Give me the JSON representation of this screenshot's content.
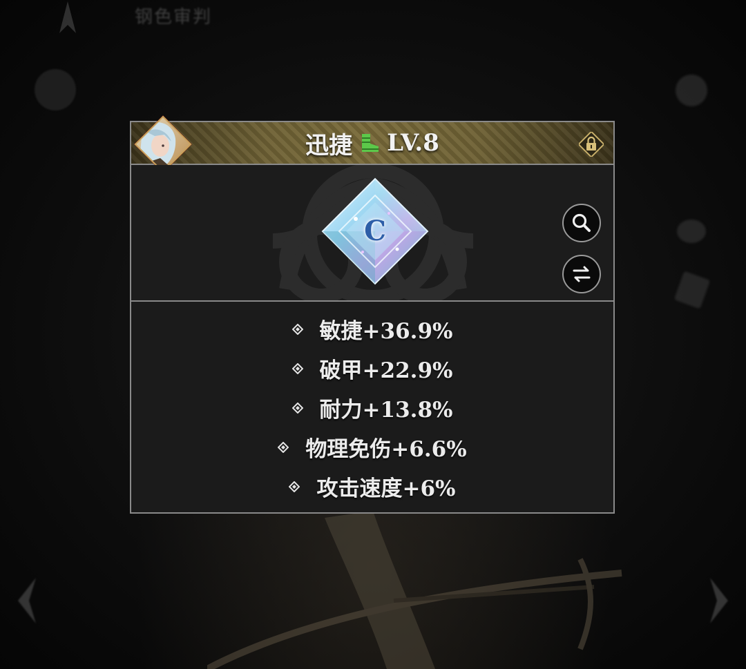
{
  "background": {
    "top_label": "钢色审判"
  },
  "panel": {
    "title": "迅捷",
    "level": "LV.8",
    "gem_grade": "C",
    "icons": {
      "portrait": "character-portrait-icon",
      "boot": "boot-icon",
      "lock": "lock-icon",
      "search": "magnifier-icon",
      "swap": "swap-arrows-icon"
    },
    "colors": {
      "header_gold": "#7a6b3a",
      "boot_green": "#5cc84a",
      "panel_border": "#8a8a8a"
    }
  },
  "stats": [
    {
      "label": "敏捷+36.9%"
    },
    {
      "label": "破甲+22.9%"
    },
    {
      "label": "耐力+13.8%"
    },
    {
      "label": "物理免伤+6.6%"
    },
    {
      "label": "攻击速度+6%"
    }
  ]
}
